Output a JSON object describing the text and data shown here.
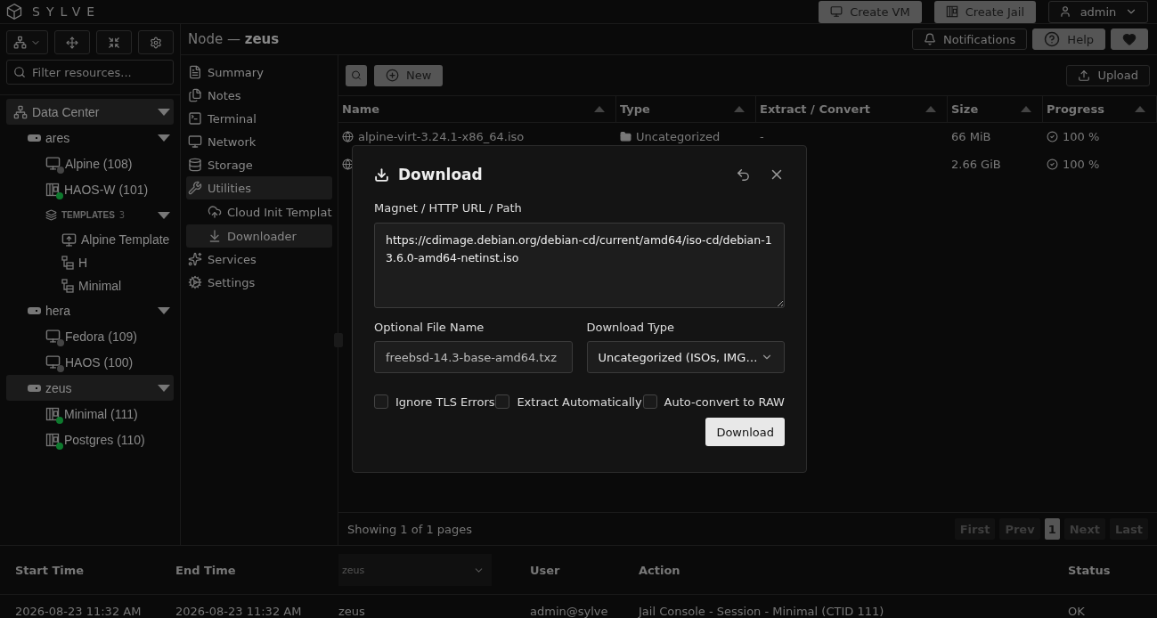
{
  "app": {
    "name": "SYLVE"
  },
  "top_bar": {
    "buttons": [
      "Create VM",
      "Create Jail"
    ],
    "user_menu": {
      "label": "admin"
    }
  },
  "sidebar": {
    "filter": {
      "placeholder": "Filter resources..."
    },
    "tree": [
      {
        "label": "Data Center",
        "kind": "datacenter",
        "selected": true,
        "expanded": true,
        "children": [
          {
            "label": "ares",
            "kind": "node",
            "selected": false,
            "expanded": true,
            "children": [
              {
                "label": "Alpine (108)",
                "kind": "vm",
                "selected": false,
                "running": false
              },
              {
                "label": "HAOS-W (101)",
                "kind": "jail",
                "selected": false,
                "running": true
              },
              {
                "label": "TEMPLATES",
                "count": "3",
                "kind": "group",
                "selected": false,
                "expanded": true,
                "children": [
                  {
                    "label": "Alpine Template",
                    "kind": "vm-template",
                    "selected": false
                  },
                  {
                    "label": "H",
                    "kind": "jail-template",
                    "selected": false
                  },
                  {
                    "label": "Minimal",
                    "kind": "jail-template",
                    "selected": false
                  }
                ]
              }
            ]
          },
          {
            "label": "hera",
            "kind": "node",
            "selected": false,
            "expanded": true,
            "children": [
              {
                "label": "Fedora (109)",
                "kind": "vm",
                "selected": false,
                "running": false
              },
              {
                "label": "HAOS (100)",
                "kind": "vm",
                "selected": false,
                "running": false
              }
            ]
          },
          {
            "label": "zeus",
            "kind": "node",
            "selected": true,
            "expanded": true,
            "children": [
              {
                "label": "Minimal (111)",
                "kind": "jail",
                "selected": false,
                "running": true
              },
              {
                "label": "Postgres (110)",
                "kind": "jail",
                "selected": false,
                "running": true
              }
            ]
          }
        ]
      }
    ]
  },
  "page_title": "Node — **zeus**",
  "header_buttons": [
    "Notifications",
    "Help"
  ],
  "nav": [
    {
      "label": "Summary",
      "selected": false
    },
    {
      "label": "Notes",
      "selected": false
    },
    {
      "label": "Terminal",
      "selected": false
    },
    {
      "label": "Network",
      "selected": false
    },
    {
      "label": "Storage",
      "selected": false
    },
    {
      "label": "Utilities",
      "selected": true,
      "children": [
        {
          "label": "Cloud Init Templat",
          "selected": false
        },
        {
          "label": "Downloader",
          "selected": true
        }
      ]
    },
    {
      "label": "Services",
      "selected": false
    },
    {
      "label": "Settings",
      "selected": false
    }
  ],
  "toolbar": {
    "new_label": "New",
    "upload_label": "Upload"
  },
  "table": {
    "columns": [
      "Name",
      "Type",
      "Extract / Convert",
      "Size",
      "Progress"
    ],
    "rows": [
      {
        "name": "alpine-virt-3.24.1-x86_64.iso",
        "type": "Uncategorized",
        "extract": "-",
        "size": "66 MiB",
        "progress": "100 %"
      },
      {
        "size": "2.66 GiB",
        "progress": "100 %"
      }
    ]
  },
  "pager": {
    "summary": "Showing 1 of 1 pages",
    "buttons": [
      {
        "label": "First",
        "selected": false
      },
      {
        "label": "Prev",
        "selected": false
      },
      {
        "label": "1",
        "selected": true
      },
      {
        "label": "Next",
        "selected": false
      },
      {
        "label": "Last",
        "selected": false
      }
    ]
  },
  "dialog": {
    "title": "Download",
    "url_label": "Magnet / HTTP URL / Path",
    "url_value": "https://cdimage.debian.org/debian-cd/current/amd64/iso-cd/debian-13.6.0-amd64-netinst.iso",
    "file_name_label": "Optional File Name",
    "file_name_placeholder": "freebsd-14.3-base-amd64.txz",
    "type_label": "Download Type",
    "type_value": "Uncategorized (ISOs, IMG…",
    "options": [
      {
        "label": "Ignore TLS Errors",
        "checked": false
      },
      {
        "label": "Extract Automatically",
        "checked": false
      },
      {
        "label": "Auto-convert to RAW",
        "checked": false
      }
    ],
    "submit_label": "Download"
  },
  "audit_log": {
    "columns": [
      "Start Time",
      "End Time",
      "User",
      "Action",
      "Status"
    ],
    "node_filter": "zeus",
    "rows": [
      {
        "start": "2026-08-23 11:32 AM",
        "end": "2026-08-23 11:32 AM",
        "node": "zeus",
        "user": "admin@sylve",
        "action": "Jail Console - Session - Minimal (CTID 111)",
        "status": "OK"
      }
    ]
  }
}
